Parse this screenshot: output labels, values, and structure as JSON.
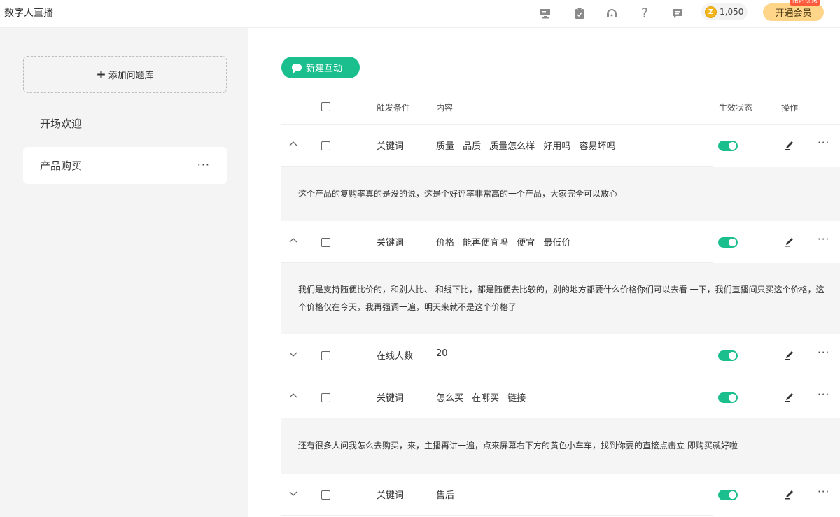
{
  "header": {
    "app_title": "数字人直播",
    "coins": "1,050",
    "vip_label": "开通会员",
    "vip_badge": "限时优惠",
    "icons": [
      "monitor-icon",
      "clipboard-icon",
      "support-icon",
      "help-icon",
      "message-icon"
    ]
  },
  "sidebar": {
    "add_label": "添加问题库",
    "items": [
      {
        "label": "开场欢迎",
        "active": false
      },
      {
        "label": "产品购买",
        "active": true
      }
    ]
  },
  "main": {
    "new_button": "新建互动",
    "columns": {
      "condition": "触发条件",
      "content": "内容",
      "status": "生效状态",
      "actions": "操作"
    },
    "rows": [
      {
        "expanded": true,
        "condition": "关键词",
        "content": "质量 品质 质量怎么样 好用吗 容易坏吗",
        "enabled": true,
        "detail": "这个产品的复购率真的是没的说，这是个好评率非常高的一个产品，大家完全可以放心"
      },
      {
        "expanded": true,
        "condition": "关键词",
        "content": "价格 能再便宜吗 便宜 最低价",
        "enabled": true,
        "detail": "我们是支持随便比价的，和别人比、 和线下比，都是随便去比较的，别的地方都要什么价格你们可以去看 一下，我们直播间只买这个价格，这个价格仅在今天，我再强调一遍，明天来就不是这个价格了"
      },
      {
        "expanded": false,
        "condition": "在线人数",
        "content": "20",
        "enabled": true,
        "detail": ""
      },
      {
        "expanded": true,
        "condition": "关键词",
        "content": "怎么买 在哪买 链接",
        "enabled": true,
        "detail": "还有很多人问我怎么去购买，来，主播再讲一遍，点来屏幕右下方的黄色小车车，找到你要的直接点击立 即购买就好啦"
      },
      {
        "expanded": false,
        "condition": "关键词",
        "content": "售后",
        "enabled": true,
        "detail": ""
      }
    ]
  },
  "colors": {
    "accent": "#1bbf8e",
    "vip": "#ffd58a",
    "sidebar_bg": "#f4f4f4",
    "detail_bg": "#f5f5f5"
  }
}
